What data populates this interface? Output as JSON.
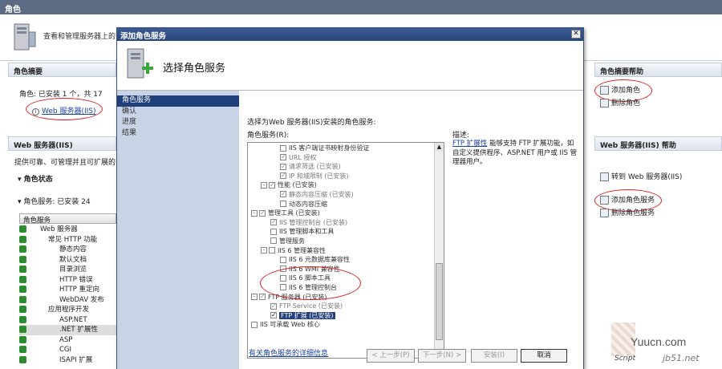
{
  "window_title": "角色",
  "banner_text": "查看和管理服务器上的...",
  "role_summary": {
    "title": "角色摘要",
    "roles_line": "角色: 已安装 1 个，共 17",
    "web_server_link": "Web 服务器(IIS)",
    "help": "角色摘要帮助",
    "add_roles": "添加角色",
    "remove_roles": "删除角色"
  },
  "web_section": {
    "title": "Web 服务器(IIS)",
    "desc": "提供可靠、可管理并且可扩展的...",
    "help": "Web 服务器(IIS) 帮助",
    "role_status": "角色状态",
    "role_services": "角色服务: 已安装 24",
    "col_header": "角色服务",
    "go_to_iis": "转到 Web 服务器(IIS)",
    "add_role_services": "添加角色服务",
    "remove_role_services": "删除角色服务",
    "tree": [
      "Web 服务器",
      "常见 HTTP 功能",
      "静态内容",
      "默认文档",
      "目录浏览",
      "HTTP 错误",
      "HTTP 重定向",
      "WebDAV 发布",
      "应用程序开发",
      "ASP.NET",
      ".NET 扩展性",
      "ASP",
      "CGI",
      "ISAPI 扩展"
    ]
  },
  "dialog": {
    "title": "添加角色服务",
    "heading": "选择角色服务",
    "nav": [
      "角色服务",
      "确认",
      "进度",
      "结果"
    ],
    "instruction": "选择为Web 服务器(IIS)安装的角色服务:",
    "tree_label": "角色服务(R):",
    "description_label": "描述:",
    "description_link": "FTP 扩展性",
    "description_text": "能够支持 FTP 扩展功能，如自定义提供程序、ASP.NET 用户或 IIS 管理器用户。",
    "more_info": "有关角色服务的详细信息",
    "services": [
      {
        "label": "IIS 客户端证书映射身份验证",
        "indent": 3,
        "state": "off"
      },
      {
        "label": "URL 授权",
        "indent": 3,
        "state": "on-dim"
      },
      {
        "label": "请求筛选   (已安装)",
        "indent": 3,
        "state": "on-dim"
      },
      {
        "label": "IP 和域限制   (已安装)",
        "indent": 3,
        "state": "on-dim"
      },
      {
        "label": "性能   (已安装)",
        "indent": 1,
        "state": "part",
        "expand": "-"
      },
      {
        "label": "静态内容压缩   (已安装)",
        "indent": 3,
        "state": "on-dim"
      },
      {
        "label": "动态内容压缩",
        "indent": 3,
        "state": "off"
      },
      {
        "label": "管理工具   (已安装)",
        "indent": 0,
        "state": "part",
        "expand": "-"
      },
      {
        "label": "IIS 管理控制台   (已安装)",
        "indent": 2,
        "state": "on-dim"
      },
      {
        "label": "IIS 管理脚本和工具",
        "indent": 2,
        "state": "off"
      },
      {
        "label": "管理服务",
        "indent": 2,
        "state": "off"
      },
      {
        "label": "IIS 6 管理兼容性",
        "indent": 1,
        "state": "off",
        "expand": "-"
      },
      {
        "label": "IIS 6 元数据库兼容性",
        "indent": 3,
        "state": "off"
      },
      {
        "label": "IIS 6 WMI 兼容性",
        "indent": 3,
        "state": "off"
      },
      {
        "label": "IIS 6 脚本工具",
        "indent": 3,
        "state": "off"
      },
      {
        "label": "IIS 6 管理控制台",
        "indent": 3,
        "state": "off"
      },
      {
        "label": "FTP 服务器   (已安装)",
        "indent": 0,
        "state": "part",
        "expand": "-"
      },
      {
        "label": "FTP Service   (已安装)",
        "indent": 2,
        "state": "on-dim"
      },
      {
        "label": "FTP 扩展   (已安装)",
        "indent": 2,
        "state": "on",
        "selected": true
      },
      {
        "label": "IIS 可承载 Web 核心",
        "indent": 0,
        "state": "off"
      }
    ],
    "buttons": {
      "prev": "< 上一步(P)",
      "next": "下一步(N) >",
      "install": "安装(I)",
      "cancel": "取消"
    }
  },
  "watermark": {
    "text": "Yuucn.com",
    "sub": "jb51.net",
    "script": "Script"
  }
}
